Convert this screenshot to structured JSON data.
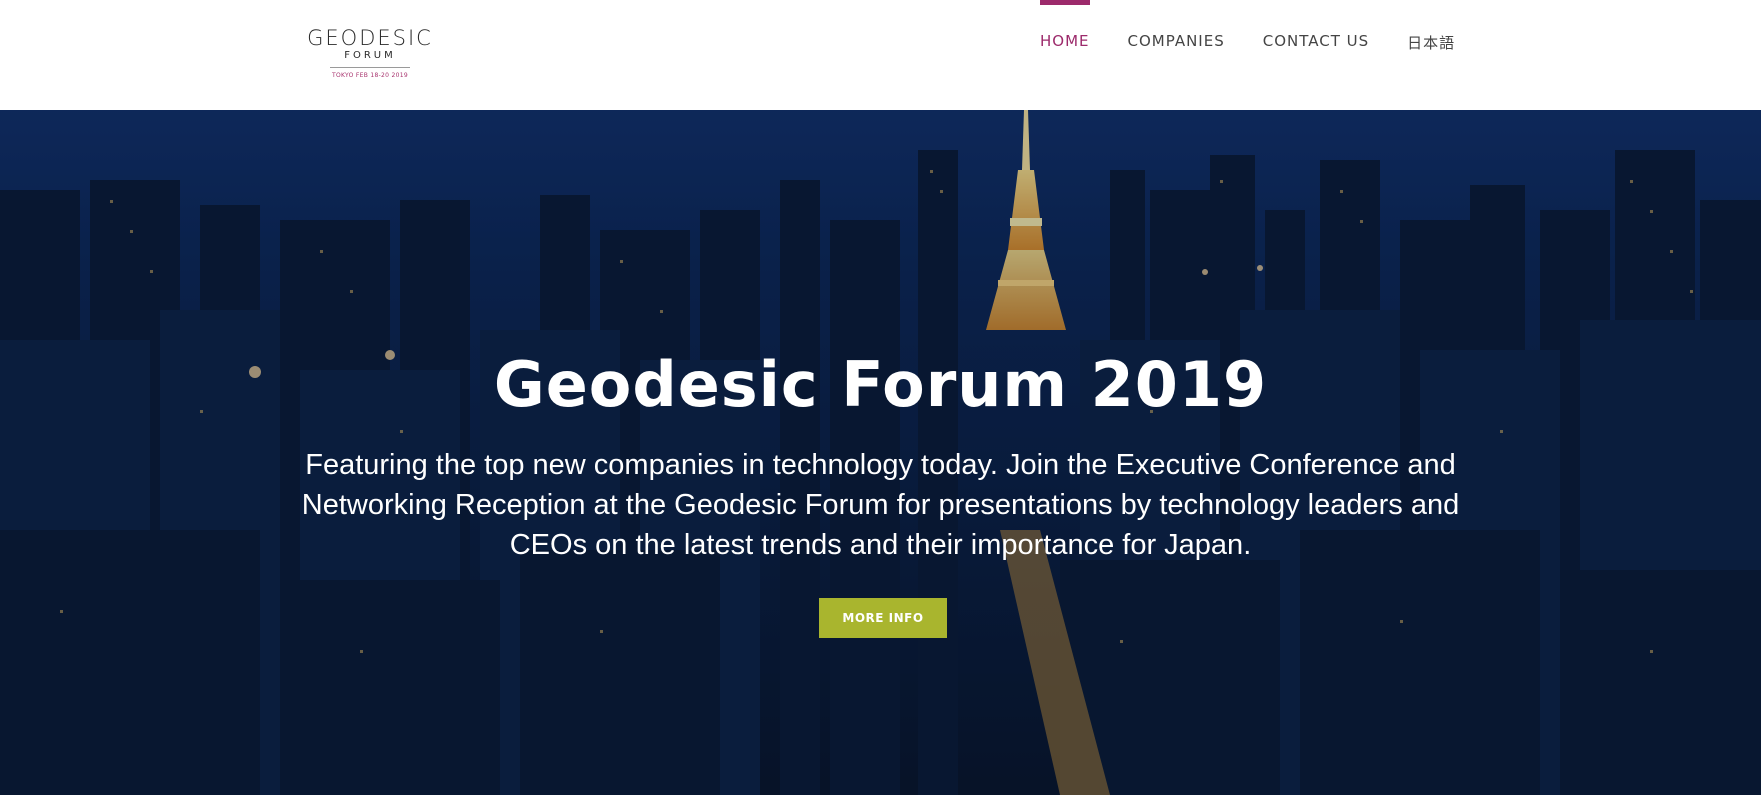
{
  "header": {
    "logo": {
      "wordmark": "GEODESIC",
      "sub": "FORUM",
      "date": "TOKYO FEB 18-20 2019"
    },
    "nav": [
      {
        "label": "HOME",
        "active": true
      },
      {
        "label": "COMPANIES",
        "active": false
      },
      {
        "label": "CONTACT US",
        "active": false
      },
      {
        "label": "日本語",
        "active": false
      }
    ]
  },
  "hero": {
    "title": "Geodesic Forum 2019",
    "description": "Featuring the top new companies in technology today. Join the Executive Conference and Networking Reception at the Geodesic Forum for presentations by technology leaders and CEOs on the latest trends and their importance for Japan.",
    "button_label": "MORE INFO",
    "background": "night-cityscape-tokyo-tower"
  },
  "colors": {
    "accent": "#9c2a6b",
    "button": "#a9b52e",
    "nav_text": "#444444"
  }
}
